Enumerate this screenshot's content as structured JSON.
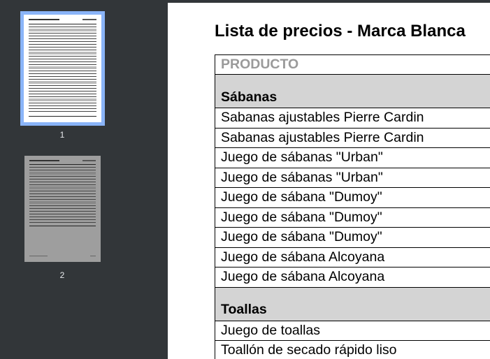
{
  "thumbnails": [
    {
      "number": "1",
      "selected": true
    },
    {
      "number": "2",
      "selected": false
    }
  ],
  "document": {
    "title": "Lista de precios - Marca Blanca",
    "column_header": "PRODUCTO",
    "sections": [
      {
        "name": "Sábanas",
        "items": [
          "Sabanas ajustables Pierre Cardin",
          "Sabanas ajustables Pierre Cardin",
          "Juego de sábanas \"Urban\"",
          "Juego de sábanas \"Urban\"",
          "Juego de sábana \"Dumoy\"",
          "Juego de sábana \"Dumoy\"",
          "Juego de sábana \"Dumoy\"",
          "Juego de sábana Alcoyana",
          "Juego de sábana Alcoyana"
        ]
      },
      {
        "name": "Toallas",
        "items": [
          "Juego de toallas",
          "Toallón de secado rápido liso"
        ]
      }
    ]
  },
  "colors": {
    "viewer_background": "#323639",
    "thumbnail_selected_border": "#8ab4f8",
    "section_background": "#d4d4d4",
    "header_text": "#9a9a9a"
  }
}
